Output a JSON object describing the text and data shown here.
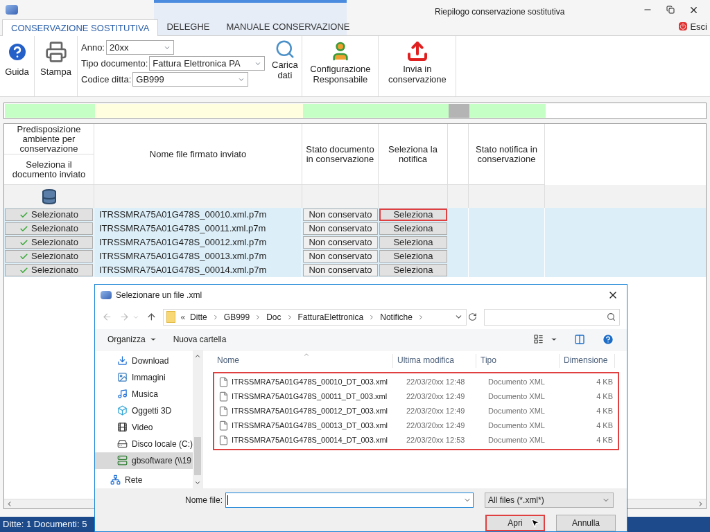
{
  "window": {
    "title": "Riepilogo conservazione sostitutiva"
  },
  "tabs": [
    {
      "label": "CONSERVAZIONE SOSTITUTIVA",
      "selected": true
    },
    {
      "label": "DELEGHE",
      "selected": false
    },
    {
      "label": "MANUALE CONSERVAZIONE",
      "selected": false
    }
  ],
  "exit_button": "Esci",
  "toolbar": {
    "help": "Guida",
    "print": "Stampa",
    "filters": [
      {
        "label": "Anno:",
        "value": "20xx"
      },
      {
        "label": "Tipo documento:",
        "value": "Fattura Elettronica PA"
      },
      {
        "label": "Codice ditta:",
        "value": "GB999"
      }
    ],
    "load": "Carica dati",
    "config": "Configurazione Responsabile",
    "send": "Invia in conservazione"
  },
  "table": {
    "band": [
      {
        "color": "#c6ffc6"
      },
      {
        "color": "#ffffe0"
      },
      {
        "color": "#c6ffc6"
      },
      {
        "color": "#c6ffc6"
      },
      {
        "color": "#b4b4b4"
      },
      {
        "color": "#c6ffc6"
      }
    ],
    "select_headers": [
      "Predisposizione ambiente per conservazione",
      "Seleziona il documento inviato"
    ],
    "columns": [
      "Nome file firmato inviato",
      "Stato documento in conservazione",
      "Seleziona la notifica",
      "Stato notifica in conservazione"
    ],
    "rows": [
      {
        "select": "Selezionato",
        "file": "ITRSSMRA75A01G478S_00010.xml.p7m",
        "status": "Non conservato",
        "notify": "Seleziona",
        "focused": true
      },
      {
        "select": "Selezionato",
        "file": "ITRSSMRA75A01G478S_00011.xml.p7m",
        "status": "Non conservato",
        "notify": "Seleziona",
        "focused": false
      },
      {
        "select": "Selezionato",
        "file": "ITRSSMRA75A01G478S_00012.xml.p7m",
        "status": "Non conservato",
        "notify": "Seleziona",
        "focused": false
      },
      {
        "select": "Selezionato",
        "file": "ITRSSMRA75A01G478S_00013.xml.p7m",
        "status": "Non conservato",
        "notify": "Seleziona",
        "focused": false
      },
      {
        "select": "Selezionato",
        "file": "ITRSSMRA75A01G478S_00014.xml.p7m",
        "status": "Non conservato",
        "notify": "Seleziona",
        "focused": false
      }
    ]
  },
  "status_bar": "Ditte: 1 Documenti: 5",
  "dialog": {
    "title": "Selezionare un file .xml",
    "path_prefix": "«",
    "path": [
      "Ditte",
      "GB999",
      "Doc",
      "FatturaElettronica",
      "Notifiche"
    ],
    "commands": [
      "Organizza",
      "Nuova cartella"
    ],
    "nav": [
      {
        "label": "Download",
        "kind": "download",
        "selected": false
      },
      {
        "label": "Immagini",
        "kind": "pictures",
        "selected": false
      },
      {
        "label": "Musica",
        "kind": "music",
        "selected": false
      },
      {
        "label": "Oggetti 3D",
        "kind": "objects",
        "selected": false
      },
      {
        "label": "Video",
        "kind": "video",
        "selected": false
      },
      {
        "label": "Disco locale (C:)",
        "kind": "drive",
        "selected": false
      },
      {
        "label": "gbsoftware (\\\\19",
        "kind": "netdrive",
        "selected": true
      },
      {
        "label": "Rete",
        "kind": "network",
        "selected": false
      }
    ],
    "columns": [
      "Nome",
      "Ultima modifica",
      "Tipo",
      "Dimensione"
    ],
    "files": [
      {
        "name": "ITRSSMRA75A01G478S_00010_DT_003.xml",
        "modified": "22/03/20xx 12:48",
        "type": "Documento XML",
        "size": "4 KB"
      },
      {
        "name": "ITRSSMRA75A01G478S_00011_DT_003.xml",
        "modified": "22/03/20xx 12:49",
        "type": "Documento XML",
        "size": "4 KB"
      },
      {
        "name": "ITRSSMRA75A01G478S_00012_DT_003.xml",
        "modified": "22/03/20xx 12:49",
        "type": "Documento XML",
        "size": "4 KB"
      },
      {
        "name": "ITRSSMRA75A01G478S_00013_DT_003.xml",
        "modified": "22/03/20xx 12:49",
        "type": "Documento XML",
        "size": "4 KB"
      },
      {
        "name": "ITRSSMRA75A01G478S_00014_DT_003.xml",
        "modified": "22/03/20xx 12:53",
        "type": "Documento XML",
        "size": "4 KB"
      }
    ],
    "filename_label": "Nome file:",
    "filter": "All files (*.xml*)",
    "buttons": [
      {
        "label": "Apri",
        "highlighted": true
      },
      {
        "label": "Annulla",
        "highlighted": false
      }
    ]
  }
}
